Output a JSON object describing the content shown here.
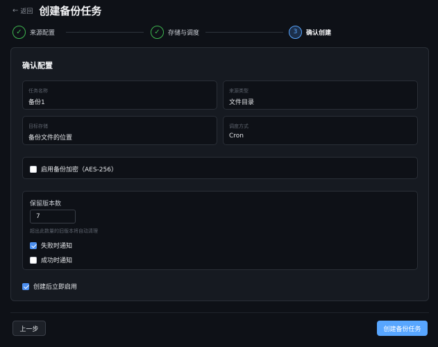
{
  "header": {
    "back_label": "返回",
    "title": "创建备份任务"
  },
  "stepper": {
    "steps": [
      {
        "label": "来源配置",
        "state": "done",
        "marker": "✓"
      },
      {
        "label": "存储与调度",
        "state": "done",
        "marker": "✓"
      },
      {
        "label": "确认创建",
        "state": "active",
        "marker": "3"
      }
    ]
  },
  "confirm": {
    "title": "确认配置",
    "fields": [
      {
        "label": "任务名称",
        "value": "备份1"
      },
      {
        "label": "来源类型",
        "value": "文件目录"
      },
      {
        "label": "目标存储",
        "value": "备份文件的位置"
      },
      {
        "label": "调度方式",
        "value": "Cron"
      }
    ],
    "encryption": {
      "label": "启用备份加密（AES-256）",
      "checked": false
    },
    "retention": {
      "title": "保留版本数",
      "value": "7",
      "hint": "超出此数量的旧版本将自动清理"
    },
    "notify_fail": {
      "label": "失败时通知",
      "checked": true
    },
    "notify_success": {
      "label": "成功时通知",
      "checked": false
    },
    "enable_after": {
      "label": "创建后立即启用",
      "checked": true
    }
  },
  "footer": {
    "prev_label": "上一步",
    "create_label": "创建备份任务"
  },
  "colors": {
    "background": "#0e1117",
    "card": "#161a21",
    "accent": "#58a6ff",
    "success": "#3fb950"
  }
}
